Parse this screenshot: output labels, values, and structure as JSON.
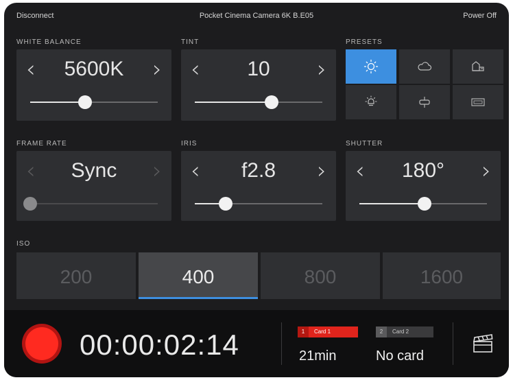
{
  "topbar": {
    "left": "Disconnect",
    "title": "Pocket Cinema Camera 6K B.E05",
    "right": "Power Off"
  },
  "white_balance": {
    "label": "WHITE BALANCE",
    "value": "5600K",
    "level": 0.43
  },
  "tint": {
    "label": "TINT",
    "value": "10",
    "level": 0.6
  },
  "presets": {
    "label": "PRESETS",
    "items": [
      {
        "icon": "sun-icon",
        "active": true
      },
      {
        "icon": "cloud-icon",
        "active": false
      },
      {
        "icon": "shade-icon",
        "active": false
      },
      {
        "icon": "tungsten-icon",
        "active": false
      },
      {
        "icon": "fluorescent-icon",
        "active": false
      },
      {
        "icon": "custom-wb-icon",
        "active": false
      }
    ]
  },
  "frame_rate": {
    "label": "FRAME RATE",
    "value": "Sync",
    "level": 0.0,
    "enabled": false
  },
  "iris": {
    "label": "IRIS",
    "value": "f2.8",
    "level": 0.24
  },
  "shutter": {
    "label": "SHUTTER",
    "value": "180°",
    "level": 0.51
  },
  "iso": {
    "label": "ISO",
    "options": [
      "200",
      "400",
      "800",
      "1600"
    ],
    "selected": "400"
  },
  "status": {
    "timecode": "00:00:02:14",
    "card1": {
      "num": "1",
      "name": "Card 1",
      "value": "21min"
    },
    "card2": {
      "num": "2",
      "name": "Card 2",
      "value": "No card"
    }
  },
  "colors": {
    "accent": "#3d8fe0",
    "record": "#ff2a20",
    "card_active": "#e0241c"
  }
}
